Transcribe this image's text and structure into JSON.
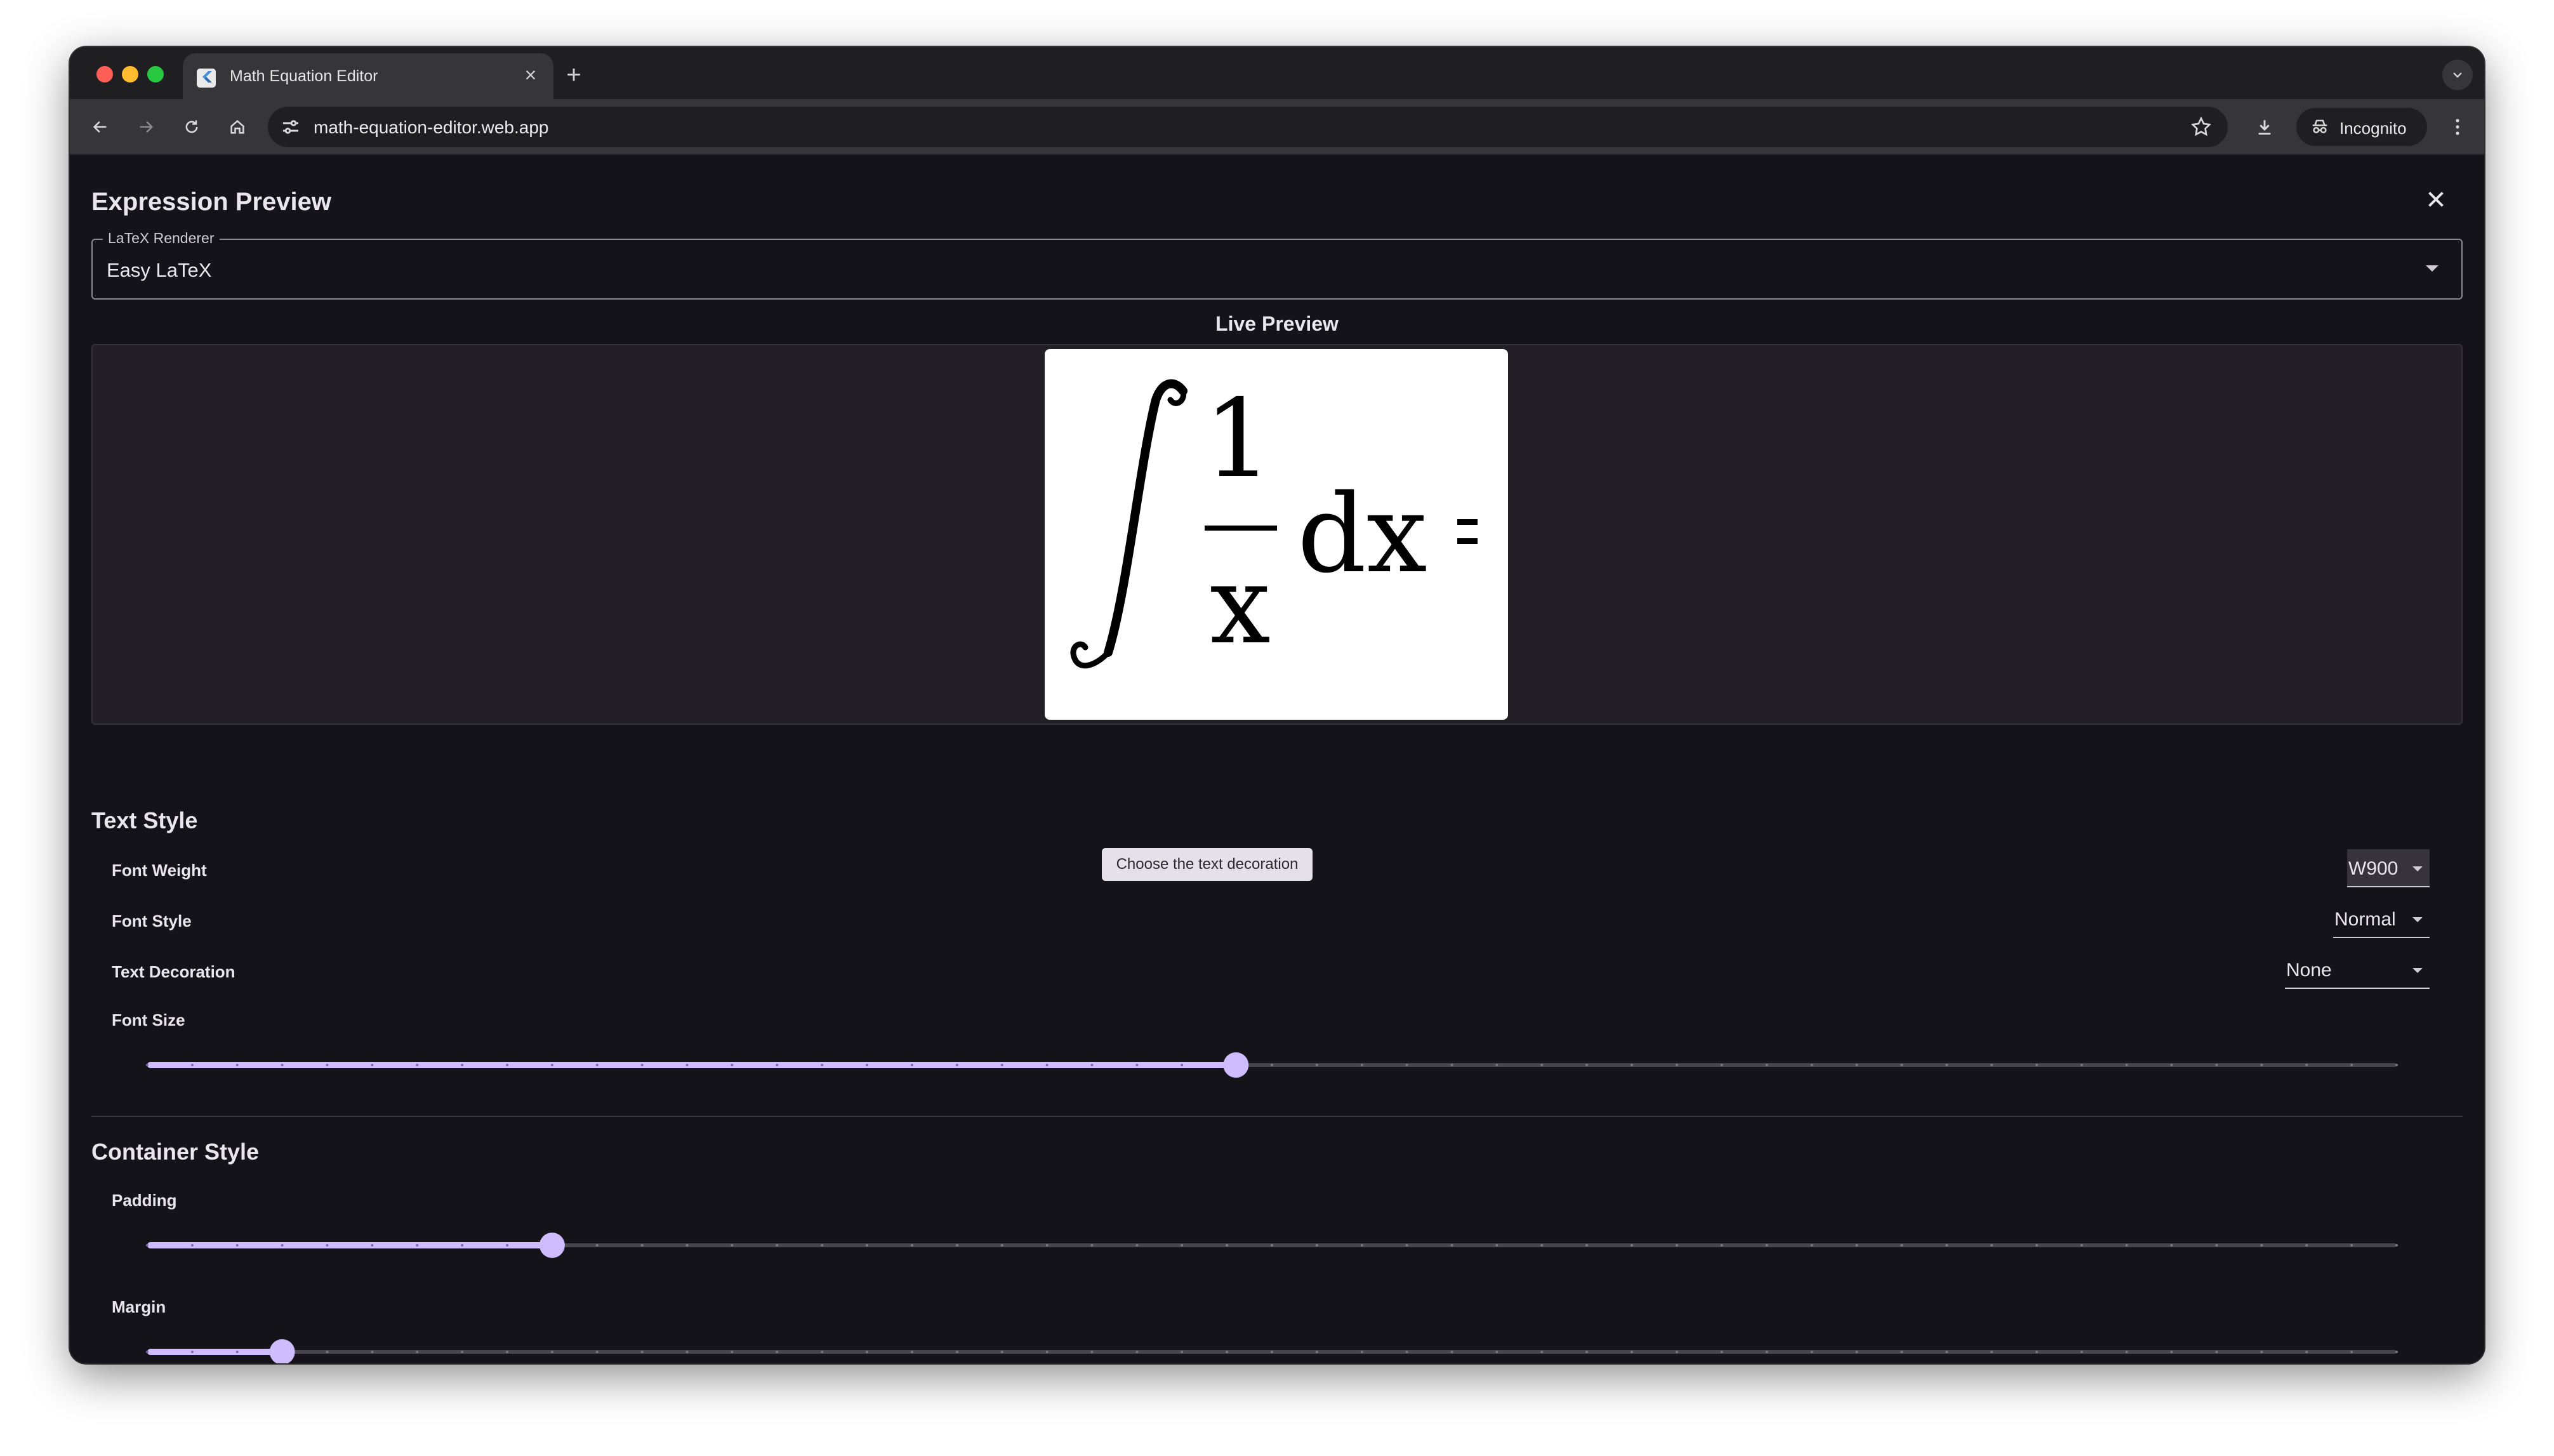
{
  "browser": {
    "tab_title": "Math Equation Editor",
    "tab_close_icon": "close-icon",
    "new_tab_icon": "plus-icon",
    "url": "math-equation-editor.web.app",
    "incognito_label": "Incognito"
  },
  "dialog": {
    "title": "Expression Preview",
    "renderer": {
      "label": "LaTeX Renderer",
      "value": "Easy LaTeX"
    },
    "live_preview_label": "Live Preview"
  },
  "text_style": {
    "title": "Text Style",
    "font_weight": {
      "label": "Font Weight",
      "value": "W900"
    },
    "font_style": {
      "label": "Font Style",
      "value": "Normal"
    },
    "text_decoration": {
      "label": "Text Decoration",
      "value": "None"
    },
    "font_size": {
      "label": "Font Size",
      "level": 0.484,
      "ticks": 51
    },
    "tooltip": "Choose the text decoration"
  },
  "container_style": {
    "title": "Container Style",
    "padding": {
      "label": "Padding",
      "level": 0.18,
      "ticks": 51
    },
    "margin": {
      "label": "Margin",
      "level": 0.06,
      "ticks": 51
    }
  },
  "colors": {
    "accent": "#cfbcff",
    "track_inactive": "#49454f",
    "background": "#15131a"
  }
}
